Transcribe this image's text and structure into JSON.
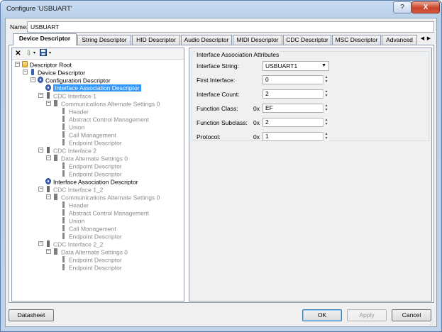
{
  "window": {
    "title": "Configure 'USBUART'",
    "help_label": "?",
    "close_label": "X"
  },
  "name": {
    "label": "Name:",
    "value": "USBUART"
  },
  "tabs": [
    {
      "label": "Device Descriptor",
      "active": true
    },
    {
      "label": "String Descriptor"
    },
    {
      "label": "HID Descriptor"
    },
    {
      "label": "Audio Descriptor"
    },
    {
      "label": "MIDI Descriptor"
    },
    {
      "label": "CDC Descriptor"
    },
    {
      "label": "MSC Descriptor"
    },
    {
      "label": "Advanced"
    }
  ],
  "tree_toolbar": {
    "delete_icon": "x-icon",
    "add_icon": "green-arrow-down-icon",
    "save_icon": "floppy-save-icon"
  },
  "tree": [
    {
      "label": "Descriptor Root",
      "icon": "folder-icon"
    },
    {
      "label": "Device Descriptor",
      "icon": "usb-device-icon"
    },
    {
      "label": "Configuration Descriptor",
      "icon": "gear-icon"
    },
    {
      "label": "Interface Association Descriptor",
      "icon": "gear-icon",
      "selected": true
    },
    {
      "label": "CDC Interface 1",
      "icon": "interface-icon",
      "dim": true
    },
    {
      "label": "Communications Alternate Settings 0",
      "icon": "alternate-icon",
      "dim": true
    },
    {
      "label": "Header",
      "icon": "item-icon",
      "dim": true
    },
    {
      "label": "Abstract Control Management",
      "icon": "item-icon",
      "dim": true
    },
    {
      "label": "Union",
      "icon": "item-icon",
      "dim": true
    },
    {
      "label": "Call Management",
      "icon": "item-icon",
      "dim": true
    },
    {
      "label": "Endpoint Descriptor",
      "icon": "item-icon",
      "dim": true
    },
    {
      "label": "CDC Interface 2",
      "icon": "interface-icon",
      "dim": true
    },
    {
      "label": "Data Alternate Settings 0",
      "icon": "alternate-icon",
      "dim": true
    },
    {
      "label": "Endpoint Descriptor",
      "icon": "item-icon",
      "dim": true
    },
    {
      "label": "Endpoint Descriptor",
      "icon": "item-icon",
      "dim": true
    },
    {
      "label": "Interface Association Descriptor",
      "icon": "gear-icon"
    },
    {
      "label": "CDC Interface 1_2",
      "icon": "interface-icon",
      "dim": true
    },
    {
      "label": "Communications Alternate Settings 0",
      "icon": "alternate-icon",
      "dim": true
    },
    {
      "label": "Header",
      "icon": "item-icon",
      "dim": true
    },
    {
      "label": "Abstract Control Management",
      "icon": "item-icon",
      "dim": true
    },
    {
      "label": "Union",
      "icon": "item-icon",
      "dim": true
    },
    {
      "label": "Call Management",
      "icon": "item-icon",
      "dim": true
    },
    {
      "label": "Endpoint Descriptor",
      "icon": "item-icon",
      "dim": true
    },
    {
      "label": "CDC Interface 2_2",
      "icon": "interface-icon",
      "dim": true
    },
    {
      "label": "Data Alternate Settings 0",
      "icon": "alternate-icon",
      "dim": true
    },
    {
      "label": "Endpoint Descriptor",
      "icon": "item-icon",
      "dim": true
    },
    {
      "label": "Endpoint Descriptor",
      "icon": "item-icon",
      "dim": true
    }
  ],
  "props": {
    "group_title": "Interface Association Attributes",
    "fields": {
      "interface_string": {
        "label": "Interface String:",
        "value": "USBUART1"
      },
      "first_interface": {
        "label": "First Interface:",
        "value": "0"
      },
      "interface_count": {
        "label": "Interface Count:",
        "value": "2"
      },
      "function_class": {
        "label": "Function Class:",
        "prefix": "0x",
        "value": "EF"
      },
      "function_subclass": {
        "label": "Function Subclass:",
        "prefix": "0x",
        "value": "2"
      },
      "protocol": {
        "label": "Protocol:",
        "prefix": "0x",
        "value": "1"
      }
    }
  },
  "buttons": {
    "datasheet": "Datasheet",
    "ok": "OK",
    "apply": "Apply",
    "cancel": "Cancel"
  },
  "colors": {
    "selection": "#3399ff",
    "dim_text": "#8a8a8a",
    "close_button": "#c9432b"
  }
}
